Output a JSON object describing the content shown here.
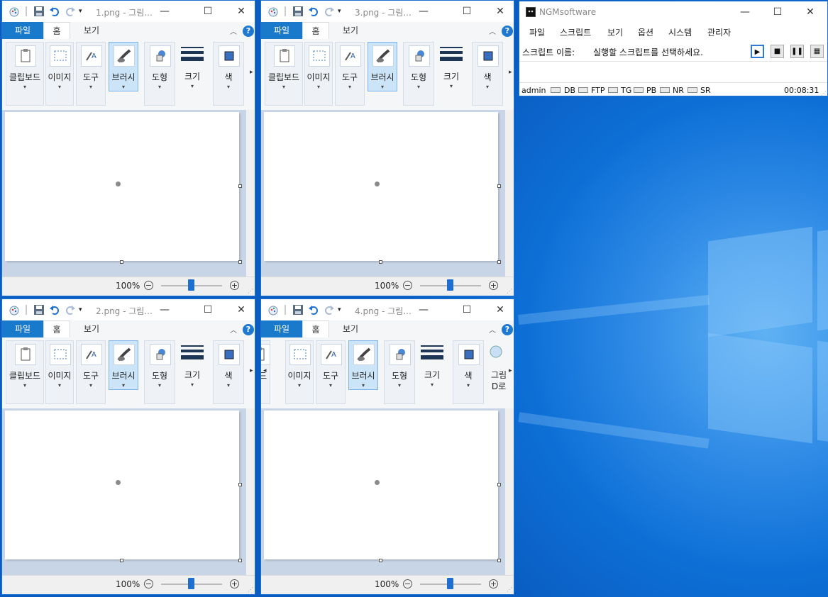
{
  "paint_windows": [
    {
      "title": "1.png - 그림...",
      "zoom": "100%"
    },
    {
      "title": "3.png - 그림...",
      "zoom": "100%"
    },
    {
      "title": "2.png - 그림...",
      "zoom": "100%"
    },
    {
      "title": "4.png - 그림...",
      "zoom": "100%"
    }
  ],
  "paint_tabs": {
    "file": "파일",
    "home": "홈",
    "view": "보기"
  },
  "ribbon": {
    "clipboard": "클립보드",
    "clipboard_partial": "보드",
    "image": "이미지",
    "tools": "도구",
    "brush": "브러시",
    "shapes": "도형",
    "size": "크기",
    "color": "색",
    "paint3d_line1": "그림",
    "paint3d_line2": "D로"
  },
  "window_controls": {
    "minimize": "—",
    "maximize": "☐",
    "close": "✕"
  },
  "ngm": {
    "title": "NGMsoftware",
    "menu": [
      "파일",
      "스크립트",
      "보기",
      "옵션",
      "시스템",
      "관리자"
    ],
    "script_label": "스크립트 이름:",
    "script_value": "실행할 스크립트를 선택하세요.",
    "status": {
      "user": "admin",
      "indicators": [
        "DB",
        "FTP",
        "TG",
        "PB",
        "NR",
        "SR"
      ],
      "time": "00:08:31"
    }
  },
  "colors": {
    "accent": "#1979ca",
    "desktop": "#0d6fd6"
  }
}
